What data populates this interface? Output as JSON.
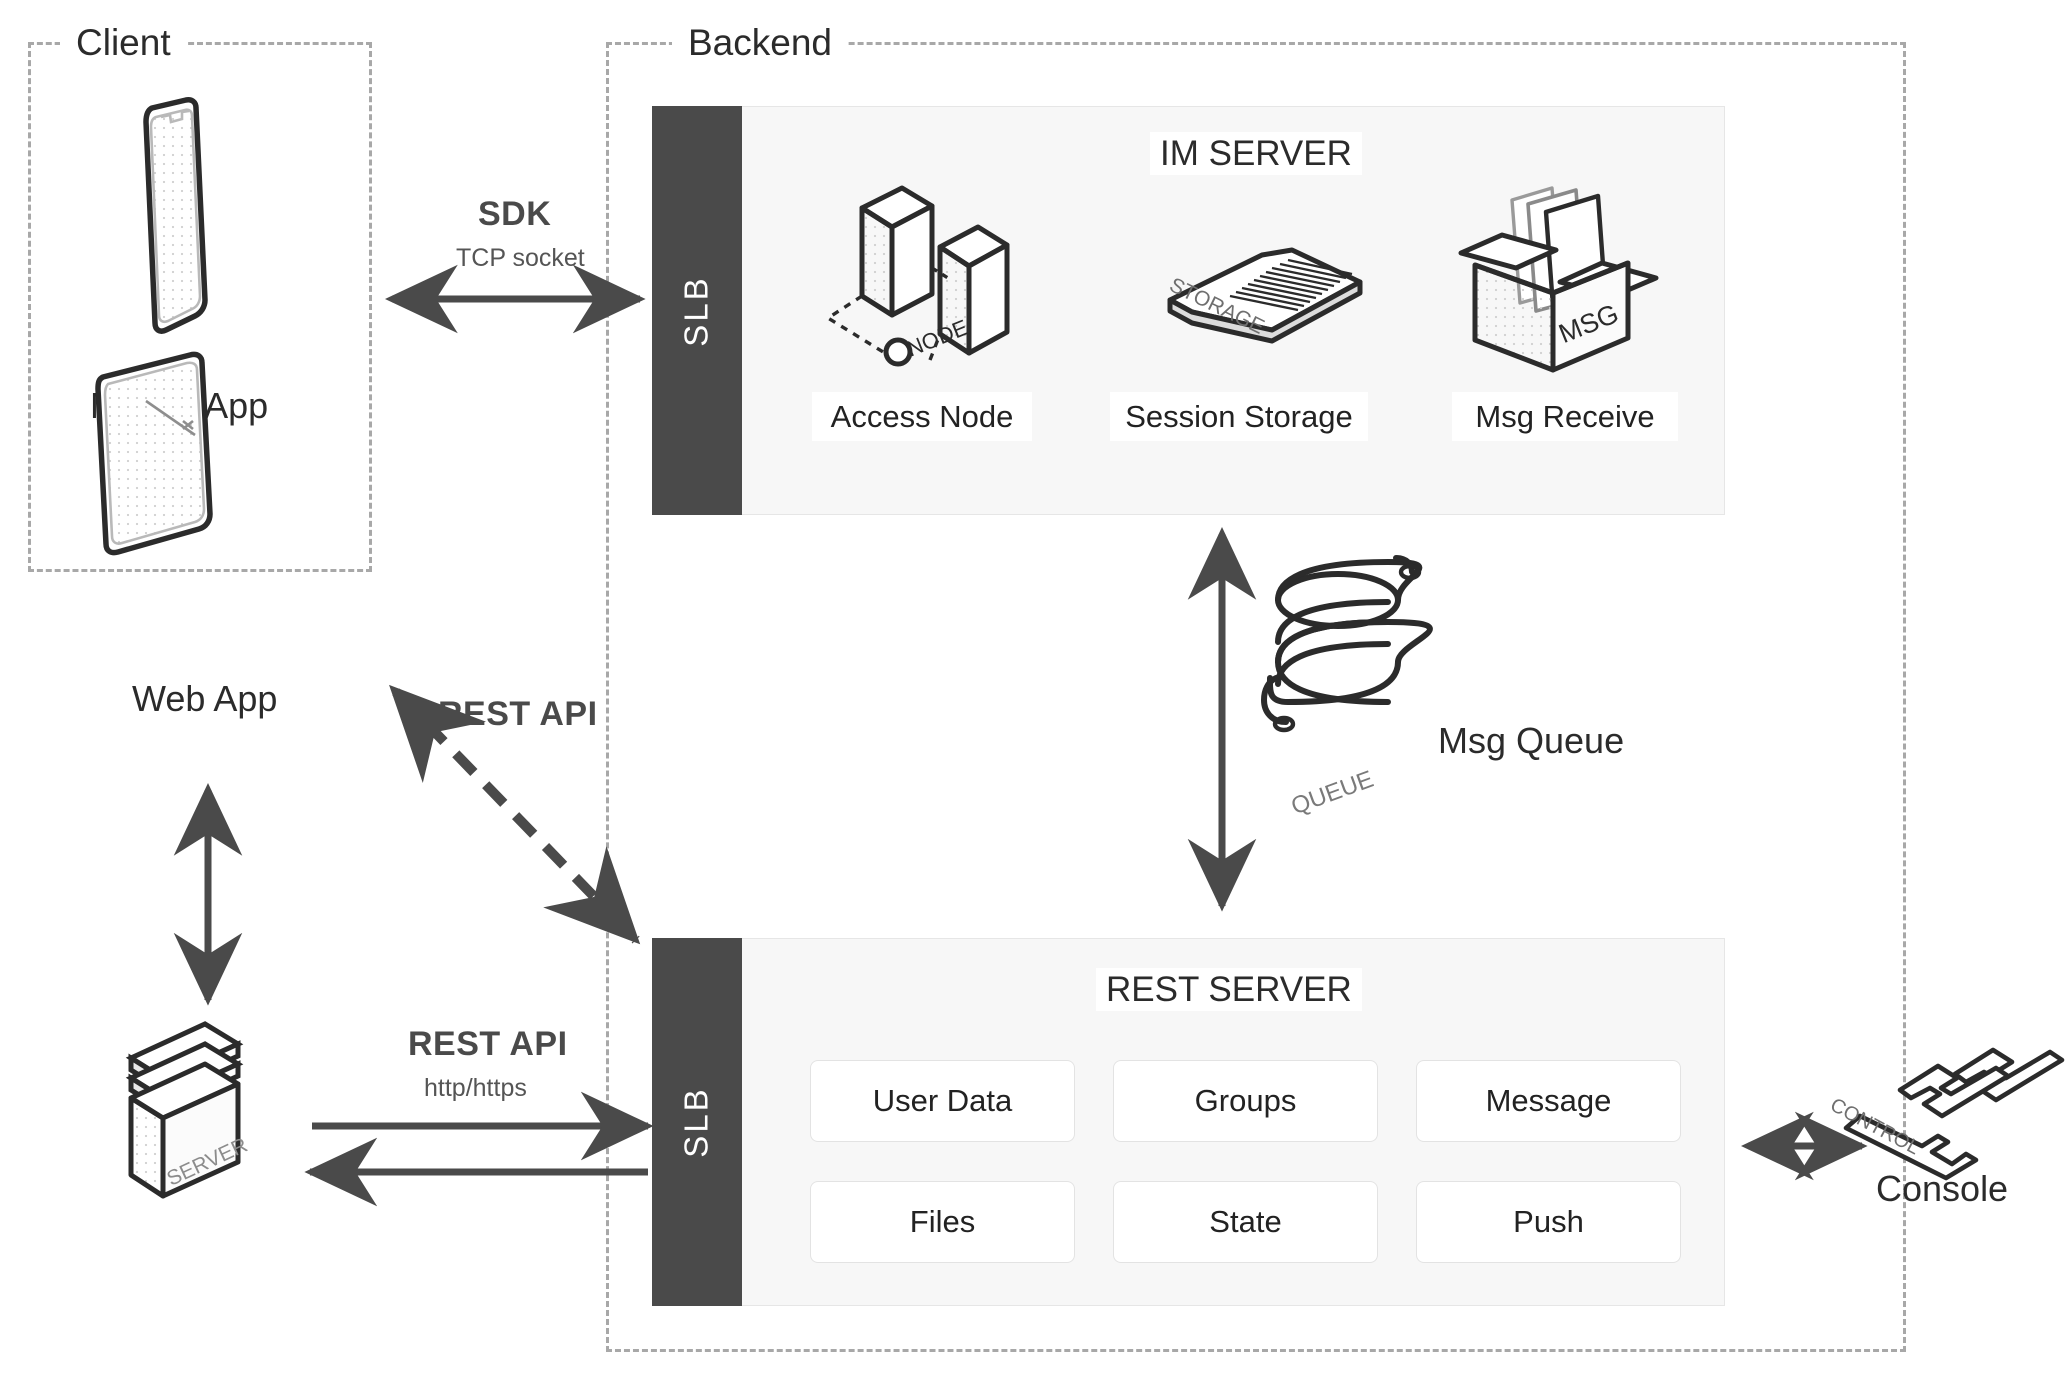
{
  "zones": {
    "client": {
      "label": "Client"
    },
    "backend": {
      "label": "Backend"
    }
  },
  "connections": {
    "sdk": {
      "title": "SDK",
      "subtitle": "TCP socket"
    },
    "rest_api_web": {
      "title": "REST API",
      "subtitle": ""
    },
    "rest_api_server": {
      "title": "REST API",
      "subtitle": "http/https"
    }
  },
  "client": {
    "mobile": {
      "label": "Mobile App",
      "icon": "phone-icon"
    },
    "web": {
      "label": "Web App",
      "icon": "browser-window-icon"
    }
  },
  "customer_server": {
    "label": "SERVER",
    "icon": "server-stack-icon"
  },
  "im_server": {
    "title": "IM SERVER",
    "slb_label": "SLB",
    "nodes": [
      {
        "label": "Access Node",
        "icon": "node-towers-icon",
        "badge": "NODE"
      },
      {
        "label": "Session Storage",
        "icon": "memory-card-icon",
        "badge": "STORAGE"
      },
      {
        "label": "Msg Receive",
        "icon": "open-box-icon",
        "badge": "MSG"
      }
    ]
  },
  "msg_queue": {
    "label": "Msg Queue",
    "icon": "coil-spring-icon",
    "badge": "QUEUE"
  },
  "rest_server": {
    "title": "REST SERVER",
    "slb_label": "SLB",
    "cards": [
      {
        "label": "User Data"
      },
      {
        "label": "Groups"
      },
      {
        "label": "Message"
      },
      {
        "label": "Files"
      },
      {
        "label": "State"
      },
      {
        "label": "Push"
      }
    ]
  },
  "console": {
    "label": "Console",
    "icon": "control-levers-icon",
    "badge": "CONTROL"
  },
  "colors": {
    "dark_bar": "#4a4a4a",
    "panel_bg": "#f7f7f7",
    "card_bg": "#ffffff",
    "dashed_border": "#a8a8a8",
    "arrow": "#4a4a4a",
    "text": "#2b2b2b"
  }
}
